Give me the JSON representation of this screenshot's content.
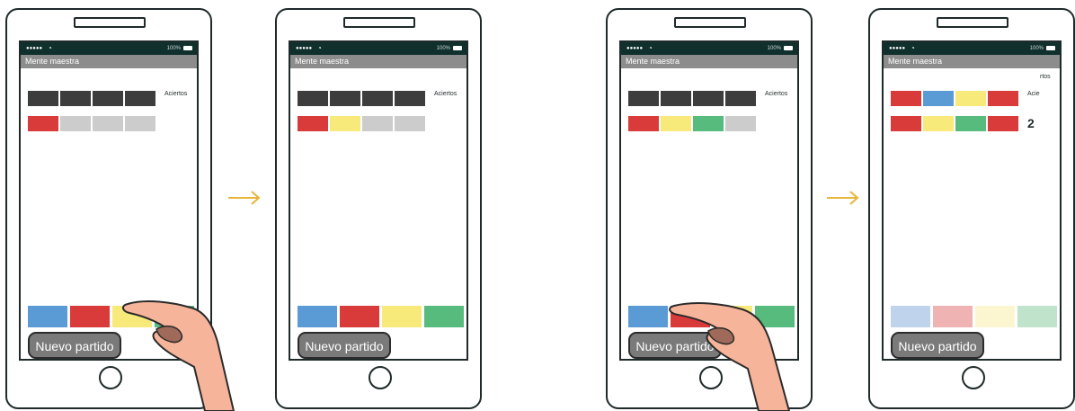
{
  "colors": {
    "dark": "#3d3d3d",
    "empty": "#cccccc",
    "red": "#d93a3a",
    "blue": "#5b9bd5",
    "yellow": "#f7e97a",
    "green": "#57bb7d",
    "blue_faded": "#bfd4ec",
    "red_faded": "#efb3b3",
    "yellow_faded": "#fbf6cf",
    "green_faded": "#bfe3cb",
    "arrow": "#e8b53a",
    "hand": "#f6b49a"
  },
  "app": {
    "title": "Mente maestra",
    "battery": "100%",
    "signal": "●●●●●",
    "aciertos": "Aciertos",
    "new_game": "Nuevo partido"
  },
  "frames": [
    {
      "row1": [
        "dark",
        "dark",
        "dark",
        "dark"
      ],
      "row2": [
        "red",
        "empty",
        "empty",
        "empty"
      ],
      "aciertos": "Aciertos",
      "hits": "",
      "palette": [
        "blue",
        "red",
        "yellow",
        "green"
      ],
      "touch": true
    },
    {
      "row1": [
        "dark",
        "dark",
        "dark",
        "dark"
      ],
      "row2": [
        "red",
        "yellow",
        "empty",
        "empty"
      ],
      "aciertos": "Aciertos",
      "hits": "",
      "palette": [
        "blue",
        "red",
        "yellow",
        "green"
      ],
      "touch": false
    },
    {
      "row1": [
        "dark",
        "dark",
        "dark",
        "dark"
      ],
      "row2": [
        "red",
        "yellow",
        "green",
        "empty"
      ],
      "aciertos": "Aciertos",
      "hits": "",
      "palette": [
        "blue",
        "red",
        "yellow",
        "green"
      ],
      "touch": true
    },
    {
      "row1": [
        "red",
        "blue",
        "yellow",
        "red"
      ],
      "row2": [
        "red",
        "yellow",
        "green",
        "red"
      ],
      "aciertos": "Acie",
      "aciertos_overflow": "rtos",
      "hits": "2",
      "palette": [
        "blue_faded",
        "red_faded",
        "yellow_faded",
        "green_faded"
      ],
      "touch": false
    }
  ]
}
